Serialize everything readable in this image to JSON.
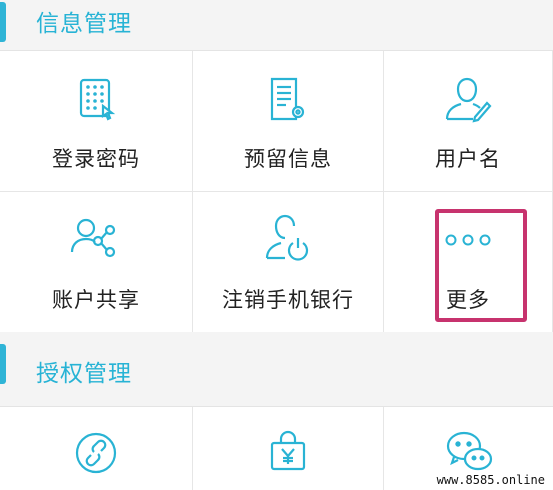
{
  "colors": {
    "accent": "#27b3d5",
    "highlight": "#c7336e",
    "background": "#f4f4f4"
  },
  "sections": {
    "info": {
      "title": "信息管理",
      "items": [
        {
          "label": "登录密码",
          "icon": "keypad-icon"
        },
        {
          "label": "预留信息",
          "icon": "document-settings-icon"
        },
        {
          "label": "用户名",
          "icon": "user-edit-icon"
        },
        {
          "label": "账户共享",
          "icon": "user-share-icon"
        },
        {
          "label": "注销手机银行",
          "icon": "user-power-icon"
        },
        {
          "label": "更多",
          "icon": "more-dots-icon"
        }
      ]
    },
    "auth": {
      "title": "授权管理",
      "items": [
        {
          "label": "",
          "icon": "link-icon"
        },
        {
          "label": "",
          "icon": "yen-bag-icon"
        },
        {
          "label": "",
          "icon": "wechat-icon"
        }
      ]
    }
  },
  "watermark": "www.8585.online"
}
